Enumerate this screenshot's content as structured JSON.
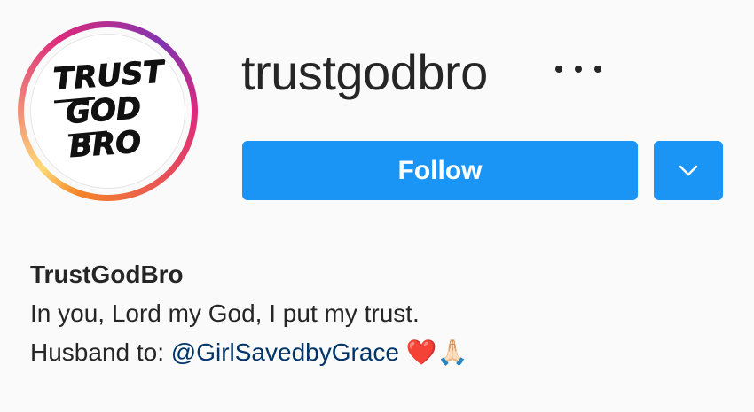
{
  "profile": {
    "username": "trustgodbro",
    "avatar_text": [
      "TRUST",
      "GOD",
      "BRO"
    ],
    "follow_label": "Follow",
    "display_name": "TrustGodBro",
    "bio_line1": "In you, Lord my God, I put my trust.",
    "bio_line2_prefix": "Husband to: ",
    "bio_mention": "@GirlSavedbyGrace",
    "bio_emoji": "❤️🙏🏻"
  },
  "colors": {
    "accent": "#1b95f5",
    "link": "#003569",
    "text": "#262626",
    "background": "#fafafa"
  },
  "icons": {
    "more": "more-options-icon",
    "dropdown": "chevron-down-icon"
  }
}
